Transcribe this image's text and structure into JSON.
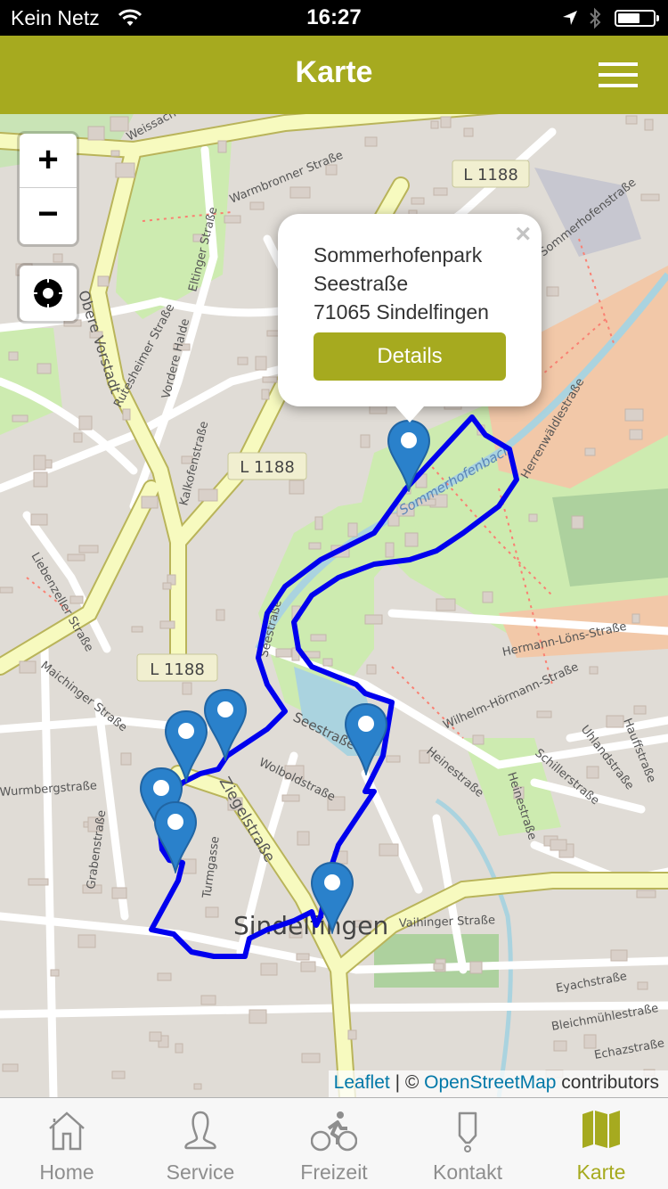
{
  "status_bar": {
    "carrier": "Kein Netz",
    "time": "16:27",
    "battery_level": 0.62
  },
  "nav_bar": {
    "title": "Karte",
    "menu_icon": "hamburger-menu-icon"
  },
  "map": {
    "controls": {
      "zoom_in": "+",
      "zoom_out": "−",
      "locate_icon": "crosshair-locate-icon"
    },
    "labels": {
      "road_l1188_a": "L 1188",
      "road_l1188_b": "L 1188",
      "road_l1188_c": "L 1188",
      "obere_vorstadt": "Obere Vorstadt",
      "warmbronner": "Warmbronner Straße",
      "eltinger": "Eltinger Straße",
      "weissach": "Weissach",
      "rutesheimer": "Rutesheimer Straße",
      "vordere_halde": "Vordere Halde",
      "kalkofen": "Kalkofenstraße",
      "liebenzeller": "Liebenzeller Straße",
      "maichinger": "Maichinger Straße",
      "seestrasse_1": "Seestraße",
      "seestrasse_2": "Seestraße",
      "wolbold": "Wolboldstraße",
      "ziegel": "Ziegelstraße",
      "wurmberg": "Wurmbergstraße",
      "graben": "Grabenstraße",
      "turmgasse": "Turmgasse",
      "sindelfingen": "Sindelfingen",
      "vaihinger": "Vaihinger Straße",
      "heine_1": "Heinestraße",
      "heine_2": "Heinestraße",
      "schiller": "Schillerstraße",
      "uhland": "Uhlandstraße",
      "hauff": "Hauffstraße",
      "hermann_loens": "Hermann-Löns-Straße",
      "wilhelm_hoermann": "Wilhelm-Hörmann-Straße",
      "herrenwaeldle": "Herrenwäldlestraße",
      "sommerhofenbach": "Sommerhofenbach",
      "eyach": "Eyachstraße",
      "bleichmuehle": "Bleichmühlestraße",
      "echaz": "Echazstraße",
      "sommerhofen": "Sommerhofenstraße"
    },
    "route_color": "#0000ee",
    "marker_color": "#2a81cb",
    "markers_count": 7,
    "popup": {
      "name": "Sommerhofenpark",
      "street": "Seestraße",
      "city": "71065 Sindelfingen",
      "button_label": "Details",
      "close": "×"
    },
    "attribution": {
      "leaflet": "Leaflet",
      "separator": " | © ",
      "osm": "OpenStreetMap",
      "suffix": " contributors"
    }
  },
  "tab_bar": {
    "active_color": "#a6aa1f",
    "items": [
      {
        "label": "Home",
        "icon": "home-icon"
      },
      {
        "label": "Service",
        "icon": "person-icon"
      },
      {
        "label": "Freizeit",
        "icon": "bicycle-icon"
      },
      {
        "label": "Kontakt",
        "icon": "contact-tag-icon"
      },
      {
        "label": "Karte",
        "icon": "map-icon",
        "active": true
      }
    ]
  }
}
